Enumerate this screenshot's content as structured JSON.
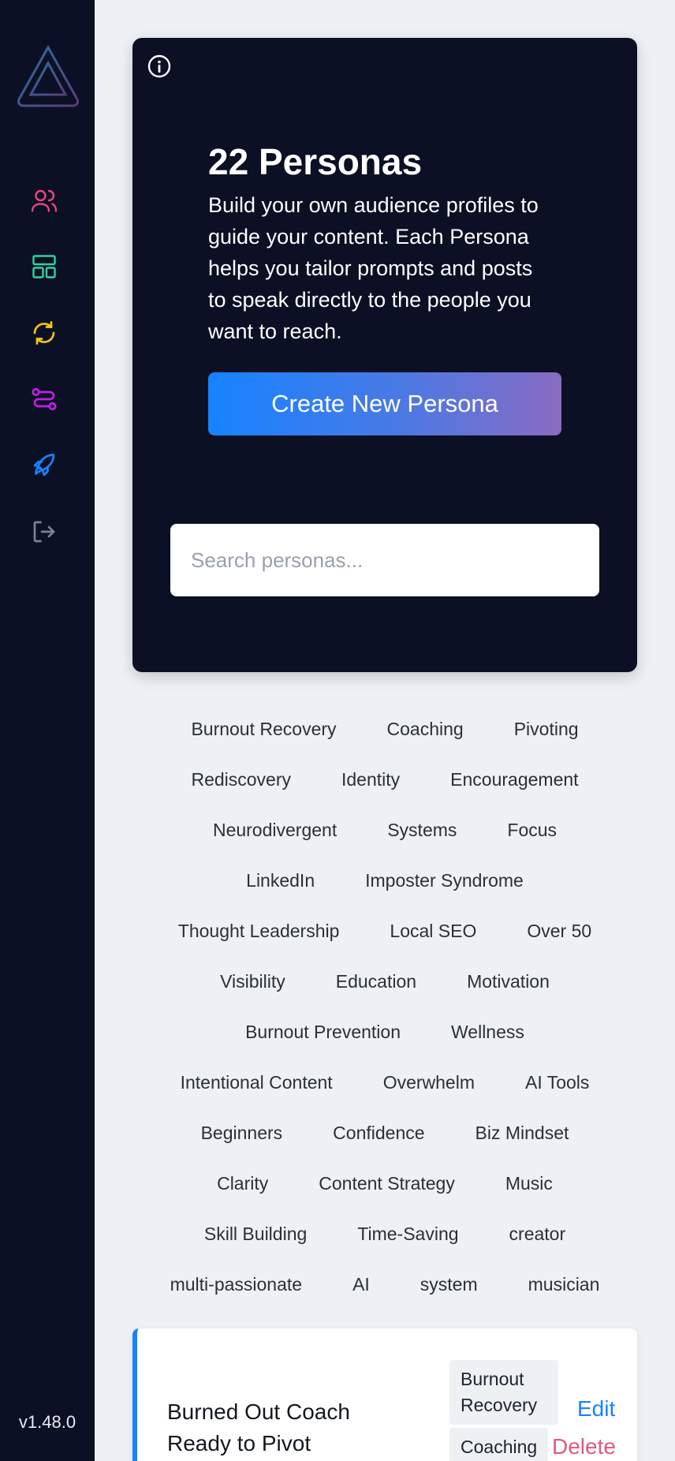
{
  "sidebar": {
    "version": "v1.48.0",
    "icons": [
      "users-icon",
      "layout-icon",
      "refresh-icon",
      "route-icon",
      "rocket-icon",
      "logout-icon"
    ],
    "colors": {
      "users": "#e8487a",
      "layout": "#2ed3a0",
      "refresh": "#f5c518",
      "route": "#c21ee8",
      "rocket": "#1683ff",
      "logout": "#7a8294"
    }
  },
  "hero": {
    "title": "22 Personas",
    "description": "Build your own audience profiles to guide your content. Each Persona helps you tailor prompts and posts to speak directly to the people you want to reach.",
    "create_label": "Create New Persona",
    "search_placeholder": "Search personas..."
  },
  "tag_rows": [
    [
      "Burnout Recovery",
      "Coaching",
      "Pivoting"
    ],
    [
      "Rediscovery",
      "Identity",
      "Encouragement"
    ],
    [
      "Neurodivergent",
      "Systems",
      "Focus"
    ],
    [
      "LinkedIn",
      "Imposter Syndrome"
    ],
    [
      "Thought Leadership",
      "Local SEO",
      "Over 50"
    ],
    [
      "Visibility",
      "Education",
      "Motivation"
    ],
    [
      "Burnout Prevention",
      "Wellness"
    ],
    [
      "Intentional Content",
      "Overwhelm",
      "AI Tools"
    ],
    [
      "Beginners",
      "Confidence",
      "Biz Mindset"
    ],
    [
      "Clarity",
      "Content Strategy",
      "Music"
    ],
    [
      "Skill Building",
      "Time-Saving",
      "creator"
    ],
    [
      "multi-passionate",
      "AI",
      "system",
      "musician"
    ]
  ],
  "card": {
    "title": "Burned Out Coach Ready to Pivot",
    "chips": [
      "Burnout Recovery",
      "Coaching"
    ],
    "edit_label": "Edit",
    "delete_label": "Delete"
  }
}
